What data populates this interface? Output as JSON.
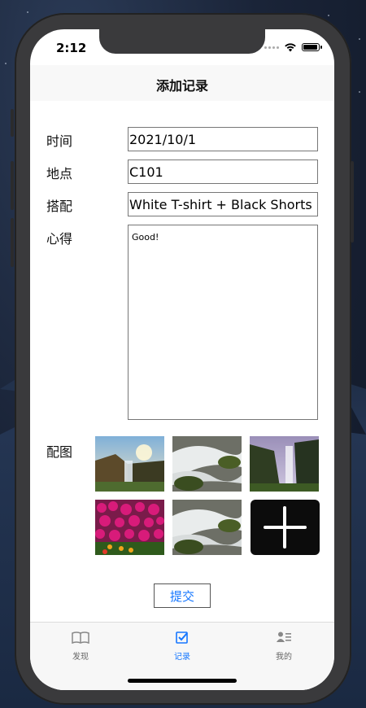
{
  "status_bar": {
    "time": "2:12"
  },
  "nav": {
    "title": "添加记录"
  },
  "form": {
    "time_label": "时间",
    "time_value": "2021/10/1",
    "place_label": "地点",
    "place_value": "C101",
    "outfit_label": "搭配",
    "outfit_value": "White T-shirt + Black Shorts",
    "notes_label": "心得",
    "notes_value": "Good!",
    "photos_label": "配图",
    "photos": [
      {
        "icon": "waterfall-sunset-photo"
      },
      {
        "icon": "waterfall-rocks-photo"
      },
      {
        "icon": "misty-waterfall-photo"
      },
      {
        "icon": "pink-flowers-photo"
      },
      {
        "icon": "waterfall-rocks-photo"
      }
    ],
    "add_photo_icon": "plus-icon",
    "submit_label": "提交"
  },
  "tabbar": {
    "items": [
      {
        "label": "发现",
        "icon": "book-icon",
        "active": false
      },
      {
        "label": "记录",
        "icon": "checkbox-icon",
        "active": true
      },
      {
        "label": "我的",
        "icon": "profile-card-icon",
        "active": false
      }
    ]
  },
  "colors": {
    "accent": "#1677ff",
    "text": "#111111",
    "border": "#777777"
  }
}
